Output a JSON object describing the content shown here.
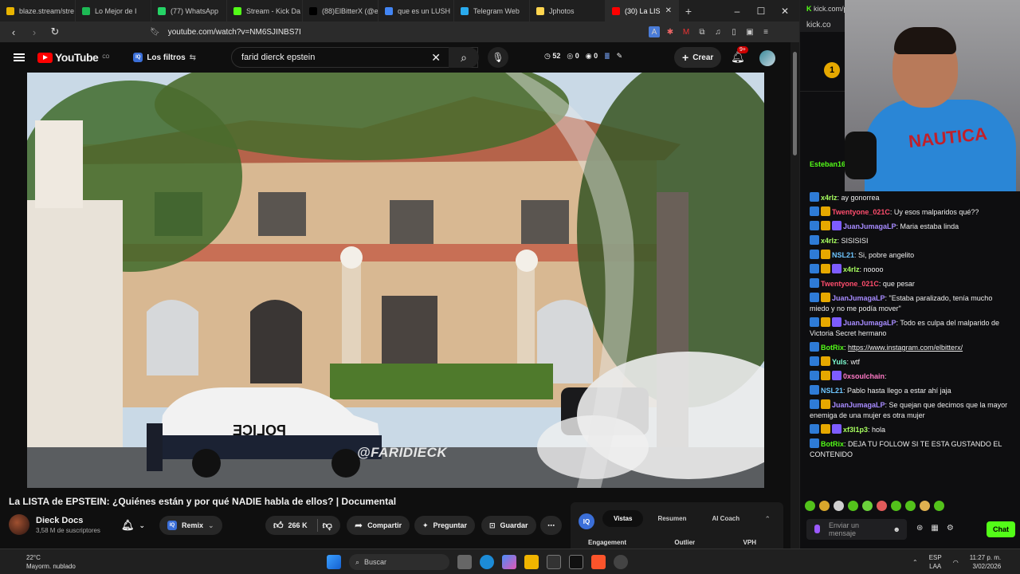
{
  "browser": {
    "tabs": [
      {
        "label": "blaze.stream/stre",
        "color": "#e8b400"
      },
      {
        "label": "Lo Mejor de I",
        "color": "#1db954"
      },
      {
        "label": "(77) WhatsApp",
        "color": "#25d366"
      },
      {
        "label": "Stream - Kick Da",
        "color": "#53fc18"
      },
      {
        "label": "(88)ElBitterX (@el",
        "color": "#000000"
      },
      {
        "label": "que es un LUSH",
        "color": "#4285f4"
      },
      {
        "label": "Telegram Web",
        "color": "#2aabee"
      },
      {
        "label": "Jphotos",
        "color": "#ffd54f"
      },
      {
        "label": "(30) La LIS",
        "color": "#ff0000"
      }
    ],
    "new_tab": "+",
    "url": "youtube.com/watch?v=NM6SJINBS7I"
  },
  "youtube": {
    "logo_text": "YouTube",
    "logo_sup": "CO",
    "filters_label": "Los filtros",
    "search_query": "farid dierck epstein",
    "stat1": "52",
    "stat2": "0",
    "stat3": "0",
    "create_label": "Crear",
    "notif_badge": "9+",
    "watermark": "@FARIDIECK",
    "video_title": "La LISTA de EPSTEIN: ¿Quiénes están y por qué NADIE habla de ellos? | Documental",
    "channel_name": "Dieck Docs",
    "channel_subs": "3,58 M de suscriptores",
    "remix_label": "Remix",
    "likes": "266 K",
    "share_label": "Compartir",
    "ask_label": "Preguntar",
    "save_label": "Guardar",
    "panel_tabs": [
      "Vistas",
      "Resumen",
      "AI Coach"
    ],
    "panel_cols": [
      "Engagement",
      "Outlier",
      "VPH"
    ]
  },
  "kick": {
    "top_url": "kick.com/p",
    "top_url2": "kick.co",
    "sub_coin": "1",
    "messages": [
      {
        "name": "x4rlz",
        "color": "#a8ff60",
        "text": "ay gonorrea"
      },
      {
        "name": "Twentyone_021C",
        "color": "#ff4d6d",
        "text": "Uy esos malparidos qué??"
      },
      {
        "name": "JuanJumagaLP",
        "color": "#a78bff",
        "text": "Maria estaba linda"
      },
      {
        "name": "x4rlz",
        "color": "#a8ff60",
        "text": "SISISISI"
      },
      {
        "name": "NSL21",
        "color": "#6ec6ff",
        "text": "Si, pobre angelito"
      },
      {
        "name": "x4rlz",
        "color": "#a8ff60",
        "text": "noooo"
      },
      {
        "name": "Twentyone_021C",
        "color": "#ff4d6d",
        "text": "que pesar"
      },
      {
        "name": "JuanJumagaLP",
        "color": "#a78bff",
        "text": "\"Estaba paralizado, tenía mucho miedo y no me podía mover\""
      },
      {
        "name": "JuanJumagaLP",
        "color": "#a78bff",
        "text": "Todo es culpa del malparido de Victoria Secret hermano"
      },
      {
        "name": "BotRix",
        "color": "#53fc18",
        "text": "https://www.instagram.com/elbitterx/"
      },
      {
        "name": "Yuls",
        "color": "#7fffd4",
        "text": "wtf"
      },
      {
        "name": "0xsoulchain",
        "color": "#ff79c6",
        "text": ""
      },
      {
        "name": "NSL21",
        "color": "#6ec6ff",
        "text": "Pablo hasta llego a estar ahí jaja"
      },
      {
        "name": "JuanJumagaLP",
        "color": "#a78bff",
        "text": "Se quejan que decimos que la mayor enemiga de una mujer es otra mujer"
      },
      {
        "name": "xf3l1p3",
        "color": "#a8ff60",
        "text": "hola"
      },
      {
        "name": "BotRix",
        "color": "#53fc18",
        "text": "DEJA TU FOLLOW SI TE ESTA GUSTANDO EL CONTENIDO"
      }
    ],
    "input_placeholder": "Enviar un mensaje",
    "chat_button": "Chat",
    "partial_name": "Esteban16"
  },
  "taskbar": {
    "temp": "22°C",
    "weather": "Mayorm. nublado",
    "search": "Buscar",
    "lang1": "ESP",
    "lang2": "LAA",
    "time": "11:27 p. m.",
    "date": "3/02/2026"
  }
}
